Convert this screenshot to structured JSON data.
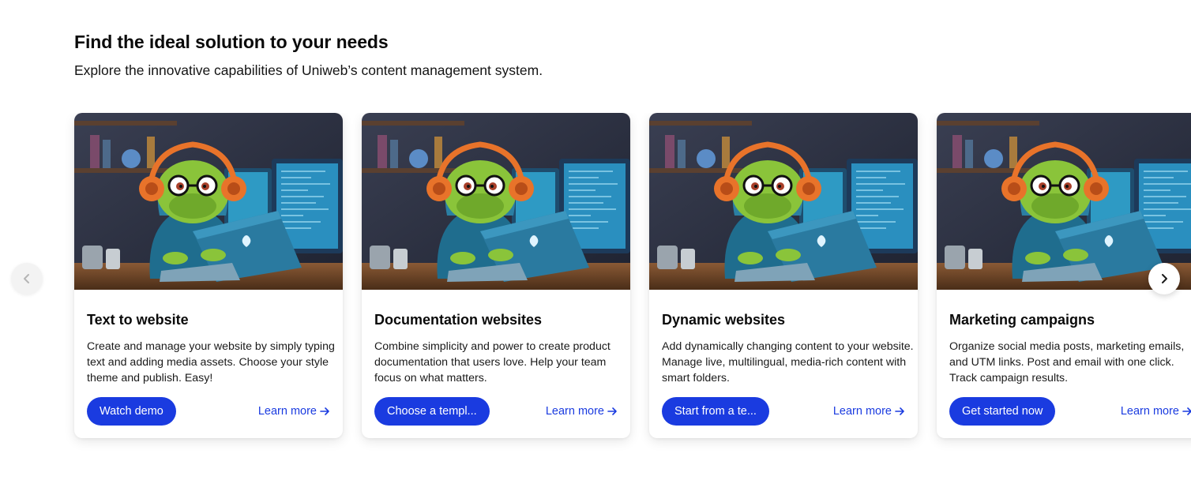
{
  "section": {
    "heading": "Find the ideal solution to your needs",
    "subheading": "Explore the innovative capabilities of Uniweb’s content management system."
  },
  "colors": {
    "accent": "#1a3be0",
    "card_background": "#ffffff"
  },
  "carousel": {
    "prev_icon": "chevron-left-icon",
    "next_icon": "chevron-right-icon",
    "cards": [
      {
        "title": "Text to website",
        "description": "Create and manage your website by simply typing text and adding media assets. Choose your style theme and publish. Easy!",
        "primary_label": "Watch demo",
        "link_label": "Learn more",
        "image_icon": "turtle-coder-illustration"
      },
      {
        "title": "Documentation websites",
        "description": "Combine simplicity and power to create product documentation that users love. Help your team focus on what matters.",
        "primary_label": "Choose a templ...",
        "link_label": "Learn more",
        "image_icon": "turtle-coder-illustration"
      },
      {
        "title": "Dynamic websites",
        "description": "Add dynamically changing content to your website. Manage live, multilingual, media-rich content with smart folders.",
        "primary_label": "Start from a te...",
        "link_label": "Learn more",
        "image_icon": "turtle-coder-illustration"
      },
      {
        "title": "Marketing campaigns",
        "description": "Organize social media posts, marketing emails, and UTM links. Post and email with one click. Track campaign results.",
        "primary_label": "Get started now",
        "link_label": "Learn more",
        "image_icon": "turtle-coder-illustration"
      }
    ]
  }
}
